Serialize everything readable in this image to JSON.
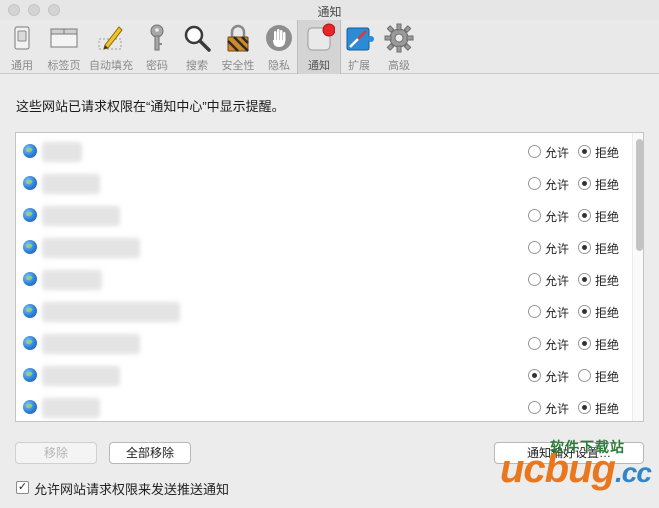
{
  "window": {
    "title": "通知"
  },
  "toolbar": [
    {
      "label": "通用",
      "icon": "switch-icon",
      "selected": false
    },
    {
      "label": "标签页",
      "icon": "tabs-icon",
      "selected": false
    },
    {
      "label": "自动填充",
      "icon": "pencil-icon",
      "selected": false
    },
    {
      "label": "密码",
      "icon": "key-icon",
      "selected": false
    },
    {
      "label": "搜索",
      "icon": "magnifier-icon",
      "selected": false
    },
    {
      "label": "安全性",
      "icon": "lock-icon",
      "selected": false
    },
    {
      "label": "隐私",
      "icon": "hand-icon",
      "selected": false
    },
    {
      "label": "通知",
      "icon": "notification-icon",
      "selected": true
    },
    {
      "label": "扩展",
      "icon": "puzzle-icon",
      "selected": false
    },
    {
      "label": "高级",
      "icon": "gear-icon",
      "selected": false
    }
  ],
  "description": "这些网站已请求权限在“通知中心”中显示提醒。",
  "options": {
    "allow": "允许",
    "deny": "拒绝"
  },
  "sites": [
    {
      "allowed": false
    },
    {
      "allowed": false
    },
    {
      "allowed": false
    },
    {
      "allowed": false
    },
    {
      "allowed": false
    },
    {
      "allowed": false
    },
    {
      "allowed": false
    },
    {
      "allowed": true
    },
    {
      "allowed": false
    }
  ],
  "buttons": {
    "remove": "移除",
    "remove_all": "全部移除",
    "notification_prefs": "通知偏好设置…"
  },
  "checkbox": {
    "label": "允许网站请求权限来发送推送通知",
    "checked": true
  },
  "watermark": {
    "top": "软件下载站",
    "logo": "ucbug",
    "suffix": ".cc"
  },
  "colors": {
    "selected_radio": "#333333",
    "globe": "#2c7fd6",
    "watermark_orange": "#e8771d",
    "watermark_blue": "#2f86c8"
  }
}
